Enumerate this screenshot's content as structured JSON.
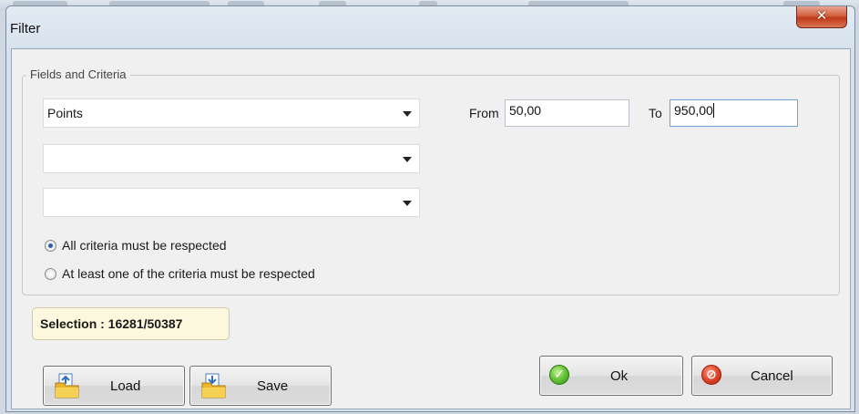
{
  "window": {
    "title": "Filter",
    "close_glyph": "✕"
  },
  "criteria": {
    "group_label": "Fields and Criteria",
    "field_1": "Points",
    "field_2": "",
    "field_3": "",
    "from_label": "From",
    "from_value": "50,00",
    "to_label": "To",
    "to_value": "950,00",
    "match_options": [
      {
        "label": "All criteria must be respected",
        "checked": true
      },
      {
        "label": "At least one of the criteria must be respected",
        "checked": false
      }
    ]
  },
  "selection": {
    "text": "Selection : 16281/50387"
  },
  "buttons": {
    "load": "Load",
    "save": "Save",
    "ok": "Ok",
    "cancel": "Cancel"
  },
  "icons": {
    "load": "folder-open-icon",
    "save": "folder-save-icon",
    "ok": "check-circle-icon",
    "cancel": "cancel-circle-icon",
    "close": "close-icon"
  },
  "colors": {
    "close_button": "#c0391b",
    "selection_badge": "#fbf8dd",
    "ok_icon": "#6cc53b",
    "cancel_icon": "#e0472a"
  }
}
